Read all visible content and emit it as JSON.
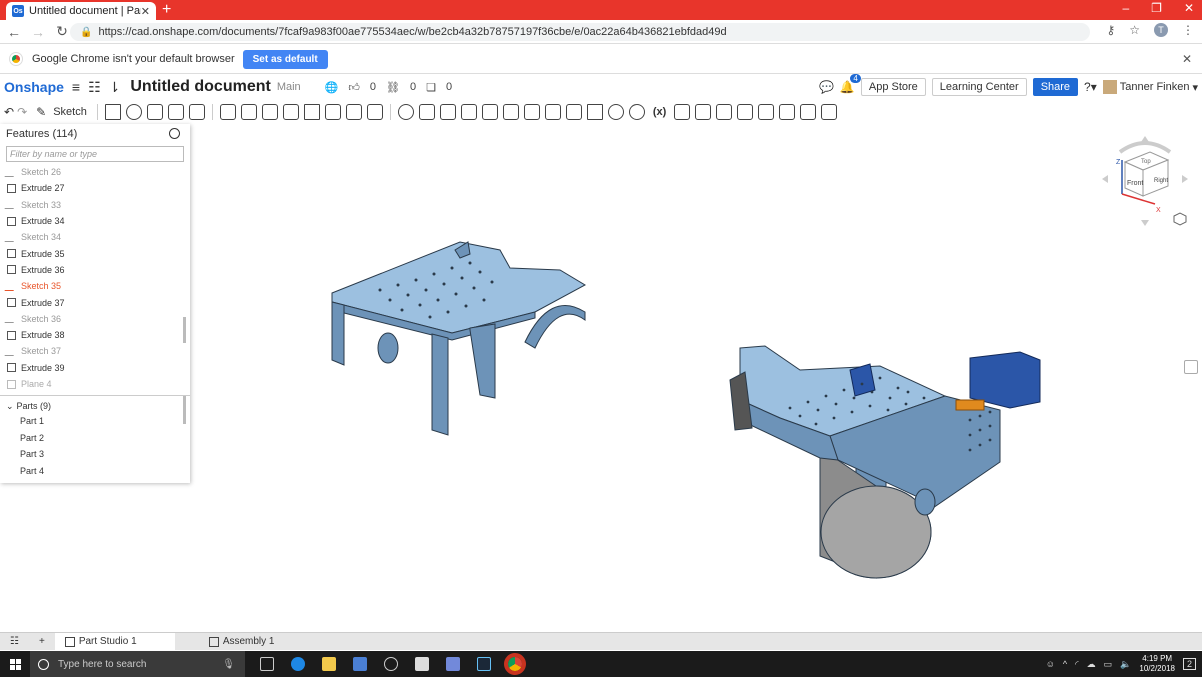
{
  "browser": {
    "tab_title": "Untitled document | Part Studio",
    "tab_favicon": "Os",
    "url": "https://cad.onshape.com/documents/7fcaf9a983f00ae775534aec/w/be2cb4a32b78757197f36cbe/e/0ac22a64b436821ebfdad49d",
    "infobar_text": "Google Chrome isn't your default browser",
    "set_default_label": "Set as default",
    "profile_initial": "T"
  },
  "header": {
    "logo": "Onshape",
    "doc_title": "Untitled document",
    "branch": "Main",
    "likes": "0",
    "links": "0",
    "copies": "0",
    "notification_count": "4",
    "app_store_label": "App Store",
    "learning_center_label": "Learning Center",
    "share_label": "Share",
    "user_name": "Tanner Finken"
  },
  "toolbar": {
    "sketch_label": "Sketch",
    "variable_label": "(x)"
  },
  "features": {
    "header": "Features (114)",
    "filter_placeholder": "Filter by name or type",
    "items": [
      {
        "label": "Sketch 26",
        "kind": "sketch"
      },
      {
        "label": "Extrude 27",
        "kind": "extrude"
      },
      {
        "label": "Sketch 33",
        "kind": "sketch"
      },
      {
        "label": "Extrude 34",
        "kind": "extrude"
      },
      {
        "label": "Sketch 34",
        "kind": "sketch"
      },
      {
        "label": "Extrude 35",
        "kind": "extrude"
      },
      {
        "label": "Extrude 36",
        "kind": "extrude"
      },
      {
        "label": "Sketch 35",
        "kind": "active"
      },
      {
        "label": "Extrude 37",
        "kind": "extrude"
      },
      {
        "label": "Sketch 36",
        "kind": "sketch"
      },
      {
        "label": "Extrude 38",
        "kind": "extrude"
      },
      {
        "label": "Sketch 37",
        "kind": "sketch"
      },
      {
        "label": "Extrude 39",
        "kind": "extrude"
      },
      {
        "label": "Plane 4",
        "kind": "plane"
      }
    ]
  },
  "parts": {
    "header": "Parts (9)",
    "items": [
      "Part 1",
      "Part 2",
      "Part 3",
      "Part 4"
    ]
  },
  "viewcube": {
    "top": "Top",
    "front": "Front",
    "right": "Right",
    "z": "Z",
    "x": "X"
  },
  "bottom_tabs": {
    "part_studio": "Part Studio 1",
    "assembly": "Assembly 1"
  },
  "taskbar": {
    "search_placeholder": "Type here to search",
    "time": "4:19 PM",
    "date": "10/2/2018",
    "notif": "2"
  },
  "colors": {
    "part_blue": "#8fb6d9",
    "part_dark": "#2b56a8",
    "accent": "#1f6ad4",
    "active_feature": "#e8552b",
    "chrome_red": "#e8352b"
  }
}
